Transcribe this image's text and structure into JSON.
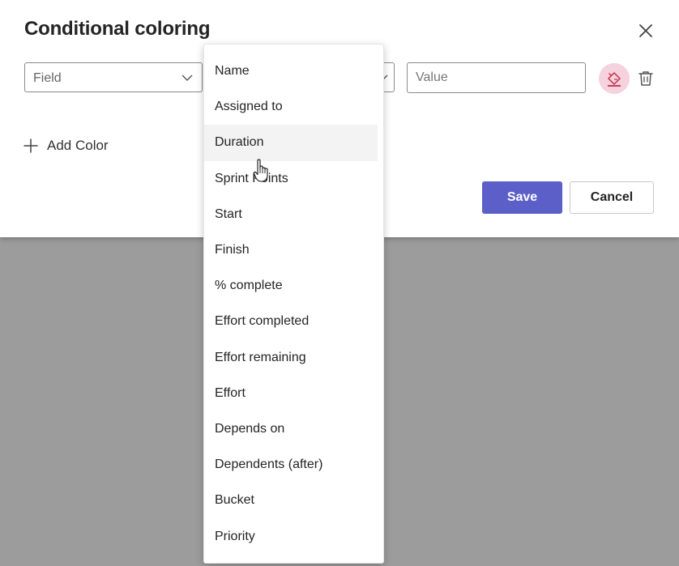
{
  "dialog": {
    "title": "Conditional coloring",
    "field_placeholder": "Field",
    "value_placeholder": "Value",
    "add_color_label": "Add Color",
    "save_label": "Save",
    "cancel_label": "Cancel"
  },
  "dropdown": {
    "items": [
      "Name",
      "Assigned to",
      "Duration",
      "Sprint Points",
      "Start",
      "Finish",
      "% complete",
      "Effort completed",
      "Effort remaining",
      "Effort",
      "Depends on",
      "Dependents (after)",
      "Bucket",
      "Priority"
    ],
    "hovered_item": "Duration"
  },
  "colors": {
    "accent": "#5b5fc7",
    "color_chip_bg": "#f6d1de",
    "color_chip_icon": "#c4314b",
    "overlay": "#9c9c9c"
  },
  "icons": {
    "close": "close-icon",
    "chevron": "chevron-down-icon",
    "color_picker": "paint-bucket-icon",
    "delete": "trash-icon",
    "add": "plus-icon",
    "cursor": "hand-pointer-icon"
  }
}
